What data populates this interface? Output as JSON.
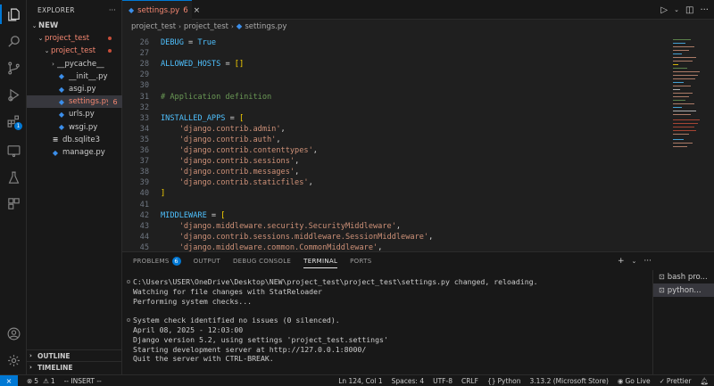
{
  "sidebar": {
    "title": "EXPLORER",
    "more": "···",
    "tree": [
      {
        "label": "NEW",
        "chevron": "⌄",
        "level": 0,
        "bold": true
      },
      {
        "label": "project_test",
        "chevron": "⌄",
        "level": 1,
        "error": true
      },
      {
        "label": "project_test",
        "chevron": "⌄",
        "level": 2,
        "error": true
      },
      {
        "label": "__pycache__",
        "chevron": "›",
        "level": 3
      },
      {
        "label": "__init__.py",
        "level": 3,
        "py": true
      },
      {
        "label": "asgi.py",
        "level": 3,
        "py": true
      },
      {
        "label": "settings.py",
        "level": 3,
        "py": true,
        "badge": "6",
        "selected": true,
        "error": true
      },
      {
        "label": "urls.py",
        "level": 3,
        "py": true
      },
      {
        "label": "wsgi.py",
        "level": 3,
        "py": true
      },
      {
        "label": "db.sqlite3",
        "level": 2,
        "db": true
      },
      {
        "label": "manage.py",
        "level": 2,
        "py": true
      }
    ],
    "outline": "OUTLINE",
    "timeline": "TIMELINE"
  },
  "activity": {
    "extensions_badge": "1"
  },
  "tab": {
    "name": "settings.py",
    "count": "6",
    "close": "×"
  },
  "breadcrumb": [
    "project_test",
    "project_test",
    "settings.py"
  ],
  "code": [
    {
      "n": "26",
      "t": [
        [
          "kw",
          "DEBUG"
        ],
        [
          "op",
          " = "
        ],
        [
          "kw",
          "True"
        ]
      ]
    },
    {
      "n": "27",
      "t": []
    },
    {
      "n": "28",
      "t": [
        [
          "kw",
          "ALLOWED_HOSTS"
        ],
        [
          "op",
          " = "
        ],
        [
          "br",
          "[]"
        ]
      ]
    },
    {
      "n": "29",
      "t": []
    },
    {
      "n": "30",
      "t": []
    },
    {
      "n": "31",
      "t": [
        [
          "cm",
          "# Application definition"
        ]
      ]
    },
    {
      "n": "32",
      "t": []
    },
    {
      "n": "33",
      "t": [
        [
          "kw",
          "INSTALLED_APPS"
        ],
        [
          "op",
          " = "
        ],
        [
          "br",
          "["
        ]
      ]
    },
    {
      "n": "34",
      "t": [
        [
          "plain",
          "    "
        ],
        [
          "str",
          "'django.contrib.admin'"
        ],
        [
          "op",
          ","
        ]
      ]
    },
    {
      "n": "35",
      "t": [
        [
          "plain",
          "    "
        ],
        [
          "str",
          "'django.contrib.auth'"
        ],
        [
          "op",
          ","
        ]
      ]
    },
    {
      "n": "36",
      "t": [
        [
          "plain",
          "    "
        ],
        [
          "str",
          "'django.contrib.contenttypes'"
        ],
        [
          "op",
          ","
        ]
      ]
    },
    {
      "n": "37",
      "t": [
        [
          "plain",
          "    "
        ],
        [
          "str",
          "'django.contrib.sessions'"
        ],
        [
          "op",
          ","
        ]
      ]
    },
    {
      "n": "38",
      "t": [
        [
          "plain",
          "    "
        ],
        [
          "str",
          "'django.contrib.messages'"
        ],
        [
          "op",
          ","
        ]
      ]
    },
    {
      "n": "39",
      "t": [
        [
          "plain",
          "    "
        ],
        [
          "str",
          "'django.contrib.staticfiles'"
        ],
        [
          "op",
          ","
        ]
      ]
    },
    {
      "n": "40",
      "t": [
        [
          "br",
          "]"
        ]
      ]
    },
    {
      "n": "41",
      "t": []
    },
    {
      "n": "42",
      "t": [
        [
          "kw",
          "MIDDLEWARE"
        ],
        [
          "op",
          " = "
        ],
        [
          "br",
          "["
        ]
      ]
    },
    {
      "n": "43",
      "t": [
        [
          "plain",
          "    "
        ],
        [
          "str",
          "'django.middleware.security.SecurityMiddleware'"
        ],
        [
          "op",
          ","
        ]
      ]
    },
    {
      "n": "44",
      "t": [
        [
          "plain",
          "    "
        ],
        [
          "str",
          "'django.contrib.sessions.middleware.SessionMiddleware'"
        ],
        [
          "op",
          ","
        ]
      ]
    },
    {
      "n": "45",
      "t": [
        [
          "plain",
          "    "
        ],
        [
          "str",
          "'django.middleware.common.CommonMiddleware'"
        ],
        [
          "op",
          ","
        ]
      ]
    }
  ],
  "panel": {
    "tabs": [
      {
        "label": "PROBLEMS",
        "badge": "6"
      },
      {
        "label": "OUTPUT"
      },
      {
        "label": "DEBUG CONSOLE"
      },
      {
        "label": "TERMINAL",
        "active": true
      },
      {
        "label": "PORTS"
      }
    ],
    "terminal_lines": [
      "C:\\Users\\USER\\OneDrive\\Desktop\\NEW\\project_test\\project_test\\settings.py changed, reloading.",
      "Watching for file changes with StatReloader",
      "Performing system checks...",
      "",
      "System check identified no issues (0 silenced).",
      "April 08, 2025 - 12:03:00",
      "Django version 5.2, using settings 'project_test.settings'",
      "Starting development server at http://127.0.0.1:8000/",
      "Quit the server with CTRL-BREAK."
    ],
    "terminals": [
      {
        "label": "bash pro...",
        "icon": "⊡"
      },
      {
        "label": "python...",
        "icon": "⊡",
        "selected": true
      }
    ]
  },
  "status": {
    "remote": "⨯",
    "errors": "5",
    "warnings": "1",
    "mode": "-- INSERT --",
    "position": "Ln 124, Col 1",
    "spaces": "Spaces: 4",
    "encoding": "UTF-8",
    "eol": "CRLF",
    "language": "Python",
    "interpreter": "3.13.2 (Microsoft Store)",
    "golive": "Go Live",
    "prettier": "Prettier"
  }
}
